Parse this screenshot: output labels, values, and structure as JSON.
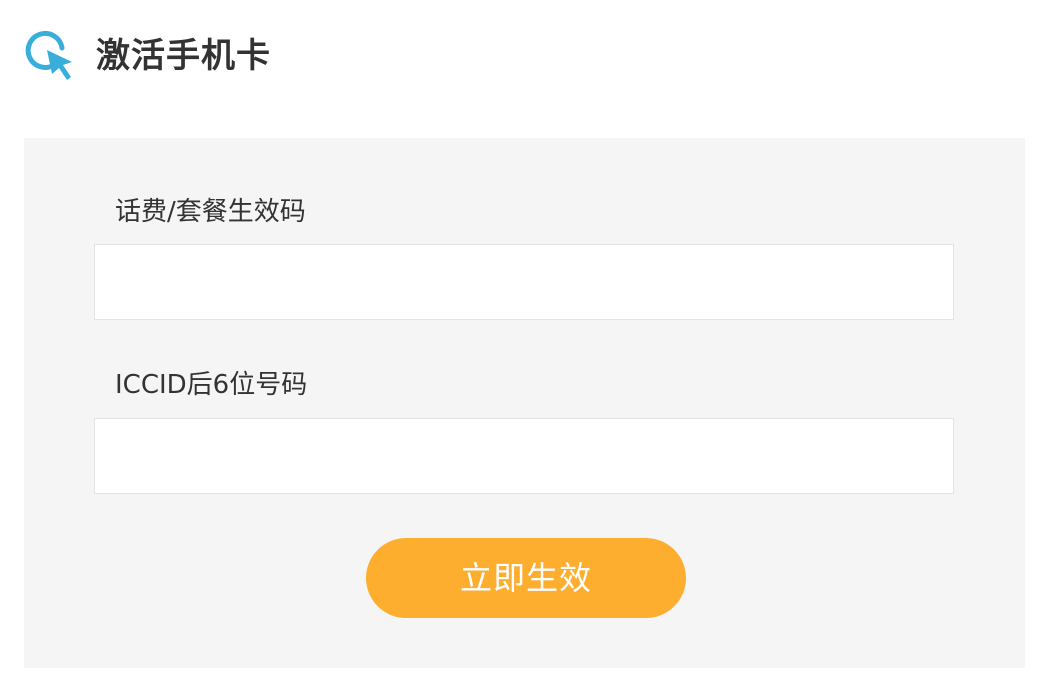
{
  "header": {
    "title": "激活手机卡",
    "icon": "click-pointer-icon",
    "icon_color": "#3aaedb"
  },
  "form": {
    "fields": [
      {
        "label": "话费/套餐生效码",
        "value": "",
        "placeholder": ""
      },
      {
        "label": "ICCID后6位号码",
        "value": "",
        "placeholder": ""
      }
    ],
    "submit_label": "立即生效",
    "submit_color": "#fdae2f"
  }
}
